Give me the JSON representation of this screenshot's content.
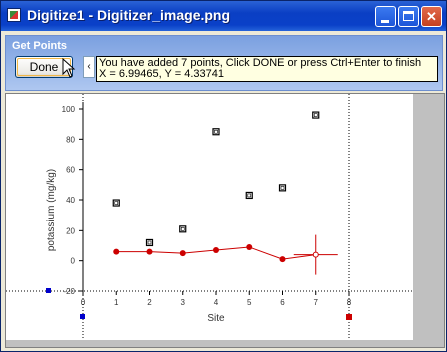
{
  "window": {
    "title": "Digitize1 - Digitizer_image.png",
    "icon": "digitizer-app-icon",
    "controls": [
      "minimize-icon",
      "maximize-icon",
      "close-icon"
    ]
  },
  "panel": {
    "title": "Get Points",
    "done_label": "Done",
    "collapse_glyph": "‹",
    "message_line1": "You have added 7 points, Click DONE or press Ctrl+Enter to finish",
    "message_line2": "X = 6.99465, Y = 4.33741"
  },
  "colors": {
    "title_bar": "#0a40c8",
    "panel": "#9fbbec",
    "series_red": "#cc0000",
    "marker_blue": "#0000cc"
  },
  "chart_data": {
    "type": "scatter",
    "xlabel": "Site",
    "ylabel": "potassium (mg/kg)",
    "xticks": [
      "0",
      "1",
      "2",
      "3",
      "4",
      "5",
      "6",
      "7",
      "8"
    ],
    "yticks": [
      "-20",
      "0",
      "20",
      "40",
      "60",
      "80",
      "100"
    ],
    "xlim": [
      0,
      8
    ],
    "ylim": [
      -20,
      100
    ],
    "series": [
      {
        "marker": "square",
        "x": [
          1,
          2,
          3,
          4,
          5,
          6,
          7
        ],
        "y": [
          38,
          12,
          21,
          85,
          43,
          48,
          96
        ]
      },
      {
        "marker": "circle",
        "x": [
          1,
          2,
          3,
          4,
          5,
          6,
          7
        ],
        "y": [
          6,
          6,
          5,
          7,
          9,
          1,
          4
        ]
      }
    ]
  }
}
